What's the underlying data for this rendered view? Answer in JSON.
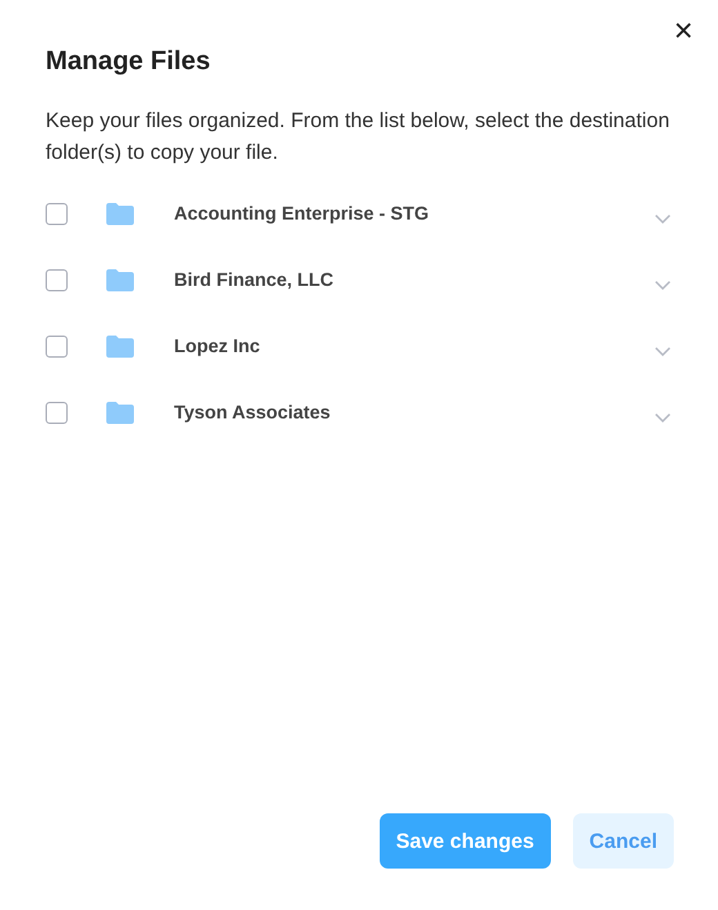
{
  "dialog": {
    "title": "Manage Files",
    "close": "×",
    "description": "Keep your files organized. From the list below, select the destination folder(s) to copy your file."
  },
  "folders": [
    {
      "name": "Accounting Enterprise - STG",
      "checked": false,
      "expanded": false
    },
    {
      "name": "Bird Finance, LLC",
      "checked": false,
      "expanded": false
    },
    {
      "name": "Lopez Inc",
      "checked": false,
      "expanded": false
    },
    {
      "name": "Tyson Associates",
      "checked": false,
      "expanded": false
    }
  ],
  "buttons": [
    {
      "label": "Save changes",
      "kind": "primary"
    },
    {
      "label": "Cancel",
      "kind": "secondary"
    }
  ]
}
